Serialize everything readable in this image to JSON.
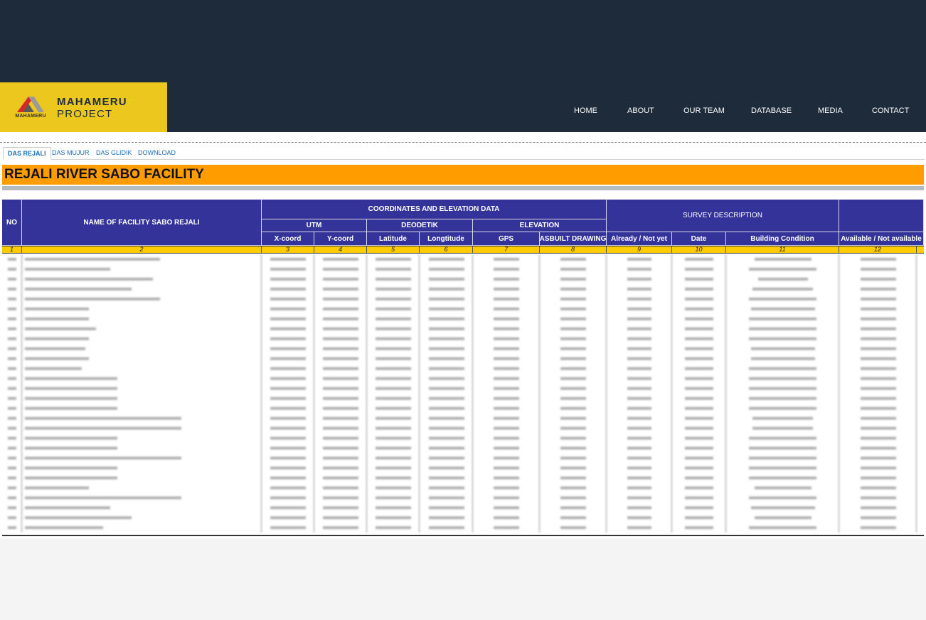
{
  "brand": {
    "mark_text": "MAHAMERU",
    "line1": "MAHAMERU",
    "line2": "PROJECT"
  },
  "nav": [
    "HOME",
    "ABOUT",
    "OUR TEAM",
    "DATABASE",
    "MEDIA",
    "CONTACT"
  ],
  "tabs": [
    {
      "label": "DAS REJALI",
      "active": true
    },
    {
      "label": "DAS MUJUR",
      "active": false
    },
    {
      "label": "DAS GLIDIK",
      "active": false
    },
    {
      "label": "DOWNLOAD",
      "active": false
    }
  ],
  "page_title": "REJALI RIVER SABO FACILITY",
  "table": {
    "headers": {
      "no": "NO",
      "name": "NAME OF FACILITY SABO REJALI",
      "coords_group": "COORDINATES AND ELEVATION DATA",
      "utm": "UTM",
      "deodetik": "DEODETIK",
      "elevation": "ELEVATION",
      "survey_group": "SURVEY DESCRIPTION",
      "x_coord": "X-coord",
      "y_coord": "Y-coord",
      "latitude": "Latitude",
      "longitude": "Longtitude",
      "gps": "GPS",
      "asbuilt": "ASBUILT DRAWING",
      "already": "Already / Not yet",
      "date": "Date",
      "condition": "Building Condition",
      "available": "Available / Not available"
    },
    "column_numbers": [
      "1",
      "2",
      "3",
      "4",
      "5",
      "6",
      "7",
      "8",
      "9",
      "10",
      "11",
      "12"
    ],
    "row_count": 28
  }
}
